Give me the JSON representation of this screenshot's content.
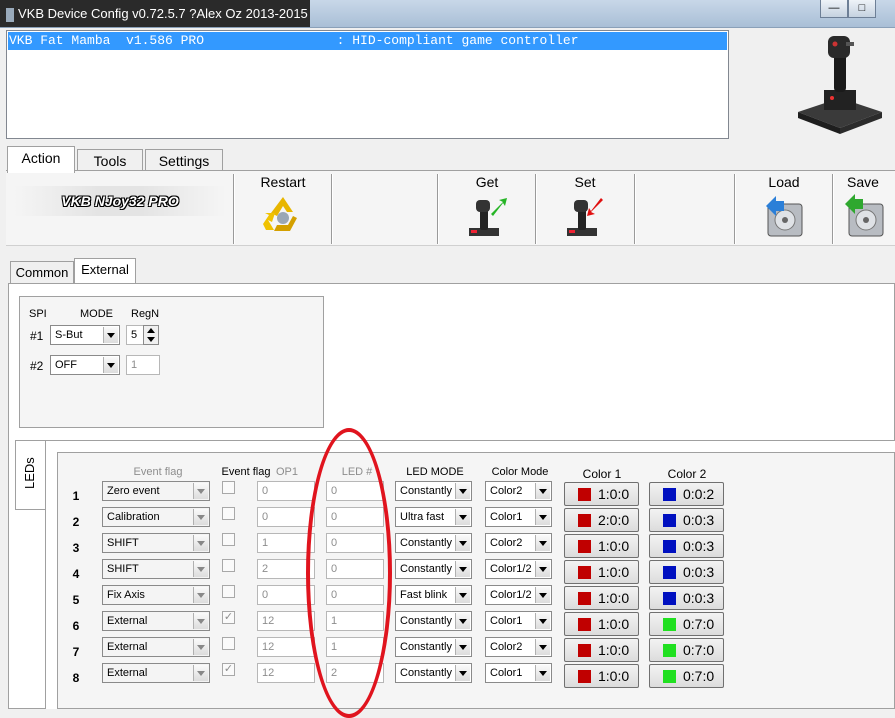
{
  "window": {
    "title": "VKB Device Config v0.72.5.7 ?Alex Oz 2013-2015"
  },
  "device_list": {
    "selected": "VKB Fat Mamba  v1.586 PRO                 : HID-compliant game controller"
  },
  "main_tabs": [
    {
      "label": "Action"
    },
    {
      "label": "Tools"
    },
    {
      "label": "Settings"
    }
  ],
  "toolbar": {
    "profile_name": "VKB NJoy32 PRO",
    "restart": "Restart",
    "get": "Get",
    "set": "Set",
    "load": "Load",
    "save": "Save"
  },
  "sub_tabs": [
    {
      "label": "Common"
    },
    {
      "label": "External"
    }
  ],
  "spi": {
    "headers": {
      "spi": "SPI",
      "mode": "MODE",
      "regn": "RegN"
    },
    "rows": [
      {
        "label": "#1",
        "mode": "S-But",
        "regn": "5"
      },
      {
        "label": "#2",
        "mode": "OFF",
        "regn": "1"
      }
    ]
  },
  "leds": {
    "tab_label": "LEDs",
    "headers": {
      "event_flag_gray": "Event flag",
      "event_flag": "Event flag",
      "op1": "OP1",
      "led_num": "LED #",
      "led_mode": "LED MODE",
      "color_mode": "Color Mode",
      "color1": "Color 1",
      "color2": "Color 2"
    },
    "rows": [
      {
        "n": "1",
        "event": "Zero event",
        "checked": false,
        "op1": "0",
        "led": "0",
        "mode": "Constantly",
        "cmode": "Color2",
        "c1": "1:0:0",
        "c1color": "#c00000",
        "c2": "0:0:2",
        "c2color": "#0010c0"
      },
      {
        "n": "2",
        "event": "Calibration",
        "checked": false,
        "op1": "0",
        "led": "0",
        "mode": "Ultra fast",
        "cmode": "Color1",
        "c1": "2:0:0",
        "c1color": "#c00000",
        "c2": "0:0:3",
        "c2color": "#0010c0"
      },
      {
        "n": "3",
        "event": "SHIFT",
        "checked": false,
        "op1": "1",
        "led": "0",
        "mode": "Constantly",
        "cmode": "Color2",
        "c1": "1:0:0",
        "c1color": "#c00000",
        "c2": "0:0:3",
        "c2color": "#0010c0"
      },
      {
        "n": "4",
        "event": "SHIFT",
        "checked": false,
        "op1": "2",
        "led": "0",
        "mode": "Constantly",
        "cmode": "Color1/2",
        "c1": "1:0:0",
        "c1color": "#c00000",
        "c2": "0:0:3",
        "c2color": "#0010c0"
      },
      {
        "n": "5",
        "event": "Fix Axis",
        "checked": false,
        "op1": "0",
        "led": "0",
        "mode": "Fast blink",
        "cmode": "Color1/2",
        "c1": "1:0:0",
        "c1color": "#c00000",
        "c2": "0:0:3",
        "c2color": "#0010c0"
      },
      {
        "n": "6",
        "event": "External",
        "checked": true,
        "op1": "12",
        "led": "1",
        "mode": "Constantly",
        "cmode": "Color1",
        "c1": "1:0:0",
        "c1color": "#c00000",
        "c2": "0:7:0",
        "c2color": "#20e020"
      },
      {
        "n": "7",
        "event": "External",
        "checked": false,
        "op1": "12",
        "led": "1",
        "mode": "Constantly",
        "cmode": "Color2",
        "c1": "1:0:0",
        "c1color": "#c00000",
        "c2": "0:7:0",
        "c2color": "#20e020"
      },
      {
        "n": "8",
        "event": "External",
        "checked": true,
        "op1": "12",
        "led": "2",
        "mode": "Constantly",
        "cmode": "Color1",
        "c1": "1:0:0",
        "c1color": "#c00000",
        "c2": "0:7:0",
        "c2color": "#20e020"
      }
    ]
  }
}
